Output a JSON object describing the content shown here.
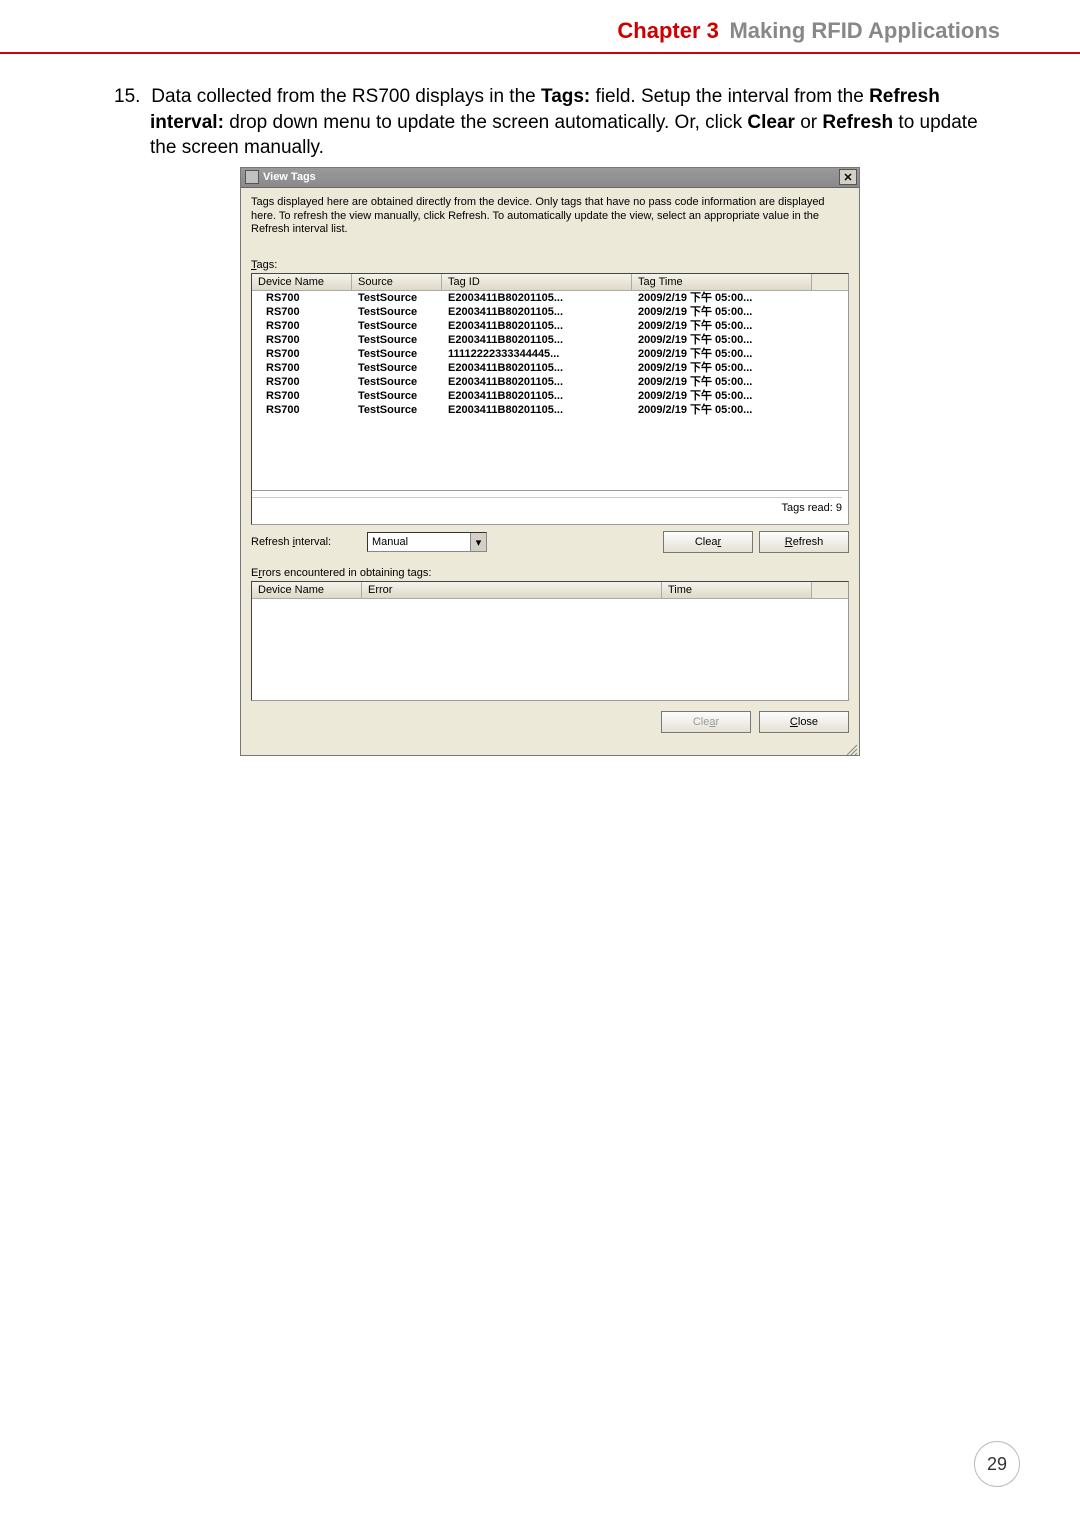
{
  "header": {
    "chapter": "Chapter 3",
    "chapter_title": "Making RFID Applications"
  },
  "step": {
    "number": "15.",
    "text_parts": [
      "Data collected from the RS700 displays in the ",
      "Tags:",
      " field. Setup the interval from the ",
      "Refresh interval:",
      " drop down menu to update the screen automatically. Or, click ",
      "Clear",
      " or ",
      "Refresh",
      " to update the screen manually."
    ]
  },
  "dialog": {
    "title": "View Tags",
    "close_glyph": "✕",
    "info": "Tags displayed here are obtained directly from the device. Only tags that have no pass code information are displayed here. To refresh the view manually, click Refresh. To automatically update the view, select an appropriate value in the Refresh interval list.",
    "tags_label_ul": "T",
    "tags_label_rest": "ags:",
    "tags_columns": [
      "Device Name",
      "Source",
      "Tag ID",
      "Tag Time"
    ],
    "tags_rows": [
      {
        "device": "RS700",
        "source": "TestSource",
        "tagid": "E2003411B80201105...",
        "time": "2009/2/19 下午 05:00..."
      },
      {
        "device": "RS700",
        "source": "TestSource",
        "tagid": "E2003411B80201105...",
        "time": "2009/2/19 下午 05:00..."
      },
      {
        "device": "RS700",
        "source": "TestSource",
        "tagid": "E2003411B80201105...",
        "time": "2009/2/19 下午 05:00..."
      },
      {
        "device": "RS700",
        "source": "TestSource",
        "tagid": "E2003411B80201105...",
        "time": "2009/2/19 下午 05:00..."
      },
      {
        "device": "RS700",
        "source": "TestSource",
        "tagid": "11112222333344445...",
        "time": "2009/2/19 下午 05:00..."
      },
      {
        "device": "RS700",
        "source": "TestSource",
        "tagid": "E2003411B80201105...",
        "time": "2009/2/19 下午 05:00..."
      },
      {
        "device": "RS700",
        "source": "TestSource",
        "tagid": "E2003411B80201105...",
        "time": "2009/2/19 下午 05:00..."
      },
      {
        "device": "RS700",
        "source": "TestSource",
        "tagid": "E2003411B80201105...",
        "time": "2009/2/19 下午 05:00..."
      },
      {
        "device": "RS700",
        "source": "TestSource",
        "tagid": "E2003411B80201105...",
        "time": "2009/2/19 下午 05:00..."
      }
    ],
    "tags_read_label": "Tags read: 9",
    "refresh_label_pre": "Refresh ",
    "refresh_label_ul": "i",
    "refresh_label_post": "nterval:",
    "refresh_value": "Manual",
    "btn_clear_ul": "r",
    "btn_clear": "Clea",
    "btn_refresh_ul": "R",
    "btn_refresh": "efresh",
    "errors_label_pre": "E",
    "errors_label_ul": "r",
    "errors_label_post": "rors encountered in obtaining tags:",
    "errors_columns": [
      "Device Name",
      "Error",
      "Time"
    ],
    "btn_clear2_pre": "Cle",
    "btn_clear2_ul": "a",
    "btn_clear2_post": "r",
    "btn_close_ul": "C",
    "btn_close": "lose"
  },
  "page_number": "29"
}
